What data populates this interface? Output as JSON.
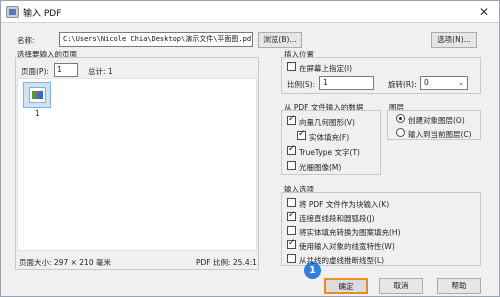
{
  "window": {
    "title": "输入 PDF",
    "close_glyph": "✕"
  },
  "name": {
    "label": "名称:",
    "value": "C:\\Users\\Nicole Chia\\Desktop\\演示文件\\平面图.pdf",
    "browse_label": "浏览(B)...",
    "options_label": "选项(N)..."
  },
  "pages": {
    "group_title": "选择要输入的页面",
    "page_label": "页面(P):",
    "page_value": "1",
    "total_label": "总计: 1",
    "thumbnail_caption": "1",
    "page_size": "页面大小: 297 × 210 毫米",
    "pdf_scale": "PDF 比例: 25.4:1"
  },
  "insert_point": {
    "group_title": "插入位置",
    "specify_on_screen": "在屏幕上指定(I)",
    "specify_checked": false,
    "scale_label": "比例(S):",
    "scale_value": "1",
    "rotation_label": "旋转(R):",
    "rotation_value": "0"
  },
  "pdf_data": {
    "group_title": "从 PDF 文件输入的数据",
    "vector_geometry": "向量几何图形(V)",
    "vector_checked": true,
    "solid_fill": "实体填充(F)",
    "solid_checked": true,
    "truetype": "TrueType 文字(T)",
    "truetype_checked": true,
    "raster": "光栅图像(M)",
    "raster_checked": false
  },
  "layers": {
    "group_title": "图层",
    "create_object_layers": "创建对象图层(O)",
    "create_selected": true,
    "current_layer": "输入到当前图层(C)",
    "current_selected": false
  },
  "import_options": {
    "group_title": "输入选项",
    "items": [
      {
        "label": "将 PDF 文件作为块输入(K)",
        "checked": false
      },
      {
        "label": "连接直线段和圆弧段(J)",
        "checked": true
      },
      {
        "label": "将实体填充转换为图案填充(H)",
        "checked": false
      },
      {
        "label": "使用输入对象的线宽特性(W)",
        "checked": true
      },
      {
        "label": "从共线的虚线推断线型(L)",
        "checked": false
      }
    ]
  },
  "buttons": {
    "ok": "确定",
    "cancel": "取消",
    "help": "帮助"
  },
  "annotation": {
    "step": "1",
    "color": "#2f7fdb",
    "highlight_color": "#e88b2c"
  }
}
